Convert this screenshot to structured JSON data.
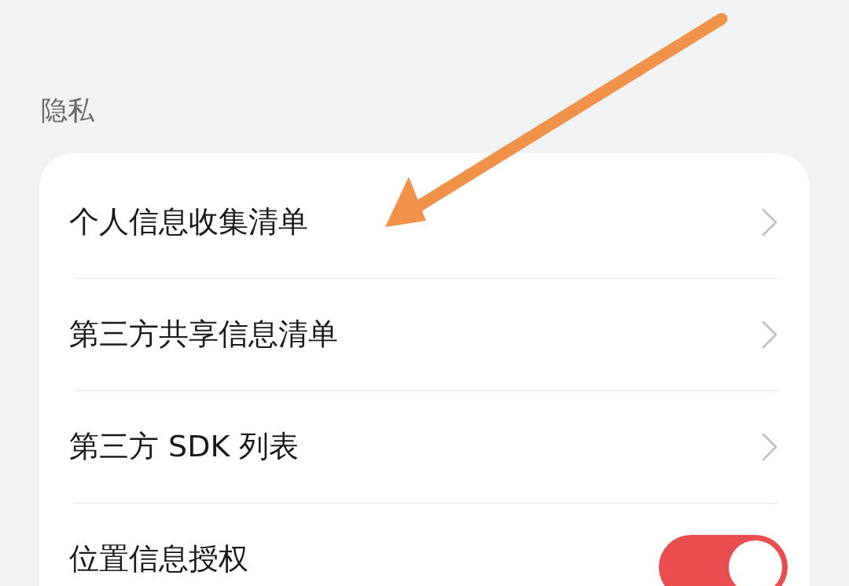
{
  "section_title": "隐私",
  "items": [
    {
      "kind": "link",
      "label": "个人信息收集清单"
    },
    {
      "kind": "link",
      "label": "第三方共享信息清单"
    },
    {
      "kind": "link",
      "label": "第三方 SDK 列表"
    },
    {
      "kind": "switch",
      "label": "位置信息授权",
      "on": true
    }
  ],
  "annotation": {
    "kind": "arrow"
  }
}
